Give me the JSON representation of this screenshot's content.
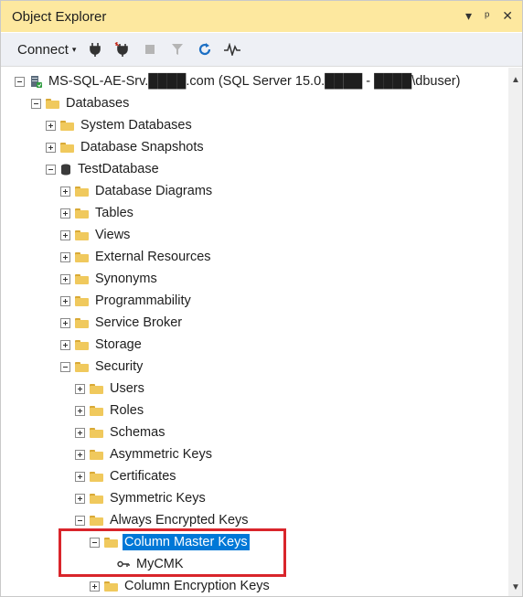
{
  "panel": {
    "title": "Object Explorer",
    "pin_glyph": "▾",
    "pin2_glyph": "ᵾA",
    "close_glyph": "✕"
  },
  "toolbar": {
    "connect_label": "Connect",
    "caret": "▾"
  },
  "tree": {
    "server": "MS-SQL-AE-Srv.████.com (SQL Server 15.0.████ - ████\\dbuser)",
    "databases": "Databases",
    "system_databases": "System Databases",
    "database_snapshots": "Database Snapshots",
    "test_database": "TestDatabase",
    "database_diagrams": "Database Diagrams",
    "tables": "Tables",
    "views": "Views",
    "external_resources": "External Resources",
    "synonyms": "Synonyms",
    "programmability": "Programmability",
    "service_broker": "Service Broker",
    "storage": "Storage",
    "security": "Security",
    "users": "Users",
    "roles": "Roles",
    "schemas": "Schemas",
    "asymmetric_keys": "Asymmetric Keys",
    "certificates": "Certificates",
    "symmetric_keys": "Symmetric Keys",
    "always_encrypted_keys": "Always Encrypted Keys",
    "column_master_keys": "Column Master Keys",
    "mycmk": "MyCMK",
    "column_encryption_keys": "Column Encryption Keys"
  },
  "colors": {
    "title_bar": "#fde89f",
    "selection": "#0078d7",
    "highlight_box": "#d9252b"
  }
}
